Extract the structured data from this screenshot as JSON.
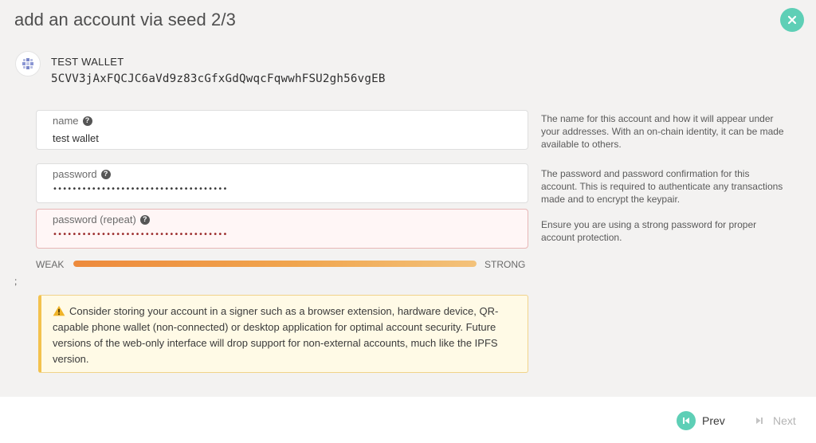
{
  "modal": {
    "title": "add an account via seed 2/3",
    "close_icon": "close-icon",
    "accent_color": "#5ecfb6"
  },
  "account": {
    "name": "TEST WALLET",
    "address": "5CVV3jAxFQCJC6aVd9z83cGfxGdQwqcFqwwhFSU2gh56vgEB",
    "identity_icon": "identicon"
  },
  "fields": {
    "name": {
      "label": "name",
      "value": "test wallet",
      "help": "The name for this account and how it will appear under your addresses. With an on-chain identity, it can be made available to others."
    },
    "password": {
      "label": "password",
      "masked_value": "••••••••••••••••••••••••••••••••••••",
      "help": "The password and password confirmation for this account. This is required to authenticate any transactions made and to encrypt the keypair."
    },
    "password_repeat": {
      "label": "password (repeat)",
      "masked_value": "••••••••••••••••••••••••••••••••••••",
      "error": true,
      "help": "Ensure you are using a strong password for proper account protection."
    }
  },
  "strength": {
    "weak_label": "WEAK",
    "strong_label": "STRONG",
    "level_percent": 100
  },
  "stray_text": ";",
  "warning": {
    "icon": "warning-icon",
    "text": "Consider storing your account in a signer such as a browser extension, hardware device, QR-capable phone wallet (non-connected) or desktop application for optimal account security. Future versions of the web-only interface will drop support for non-external accounts, much like the IPFS version."
  },
  "footer": {
    "prev_label": "Prev",
    "next_label": "Next",
    "prev_icon": "step-backward-icon",
    "next_icon": "step-forward-icon"
  }
}
